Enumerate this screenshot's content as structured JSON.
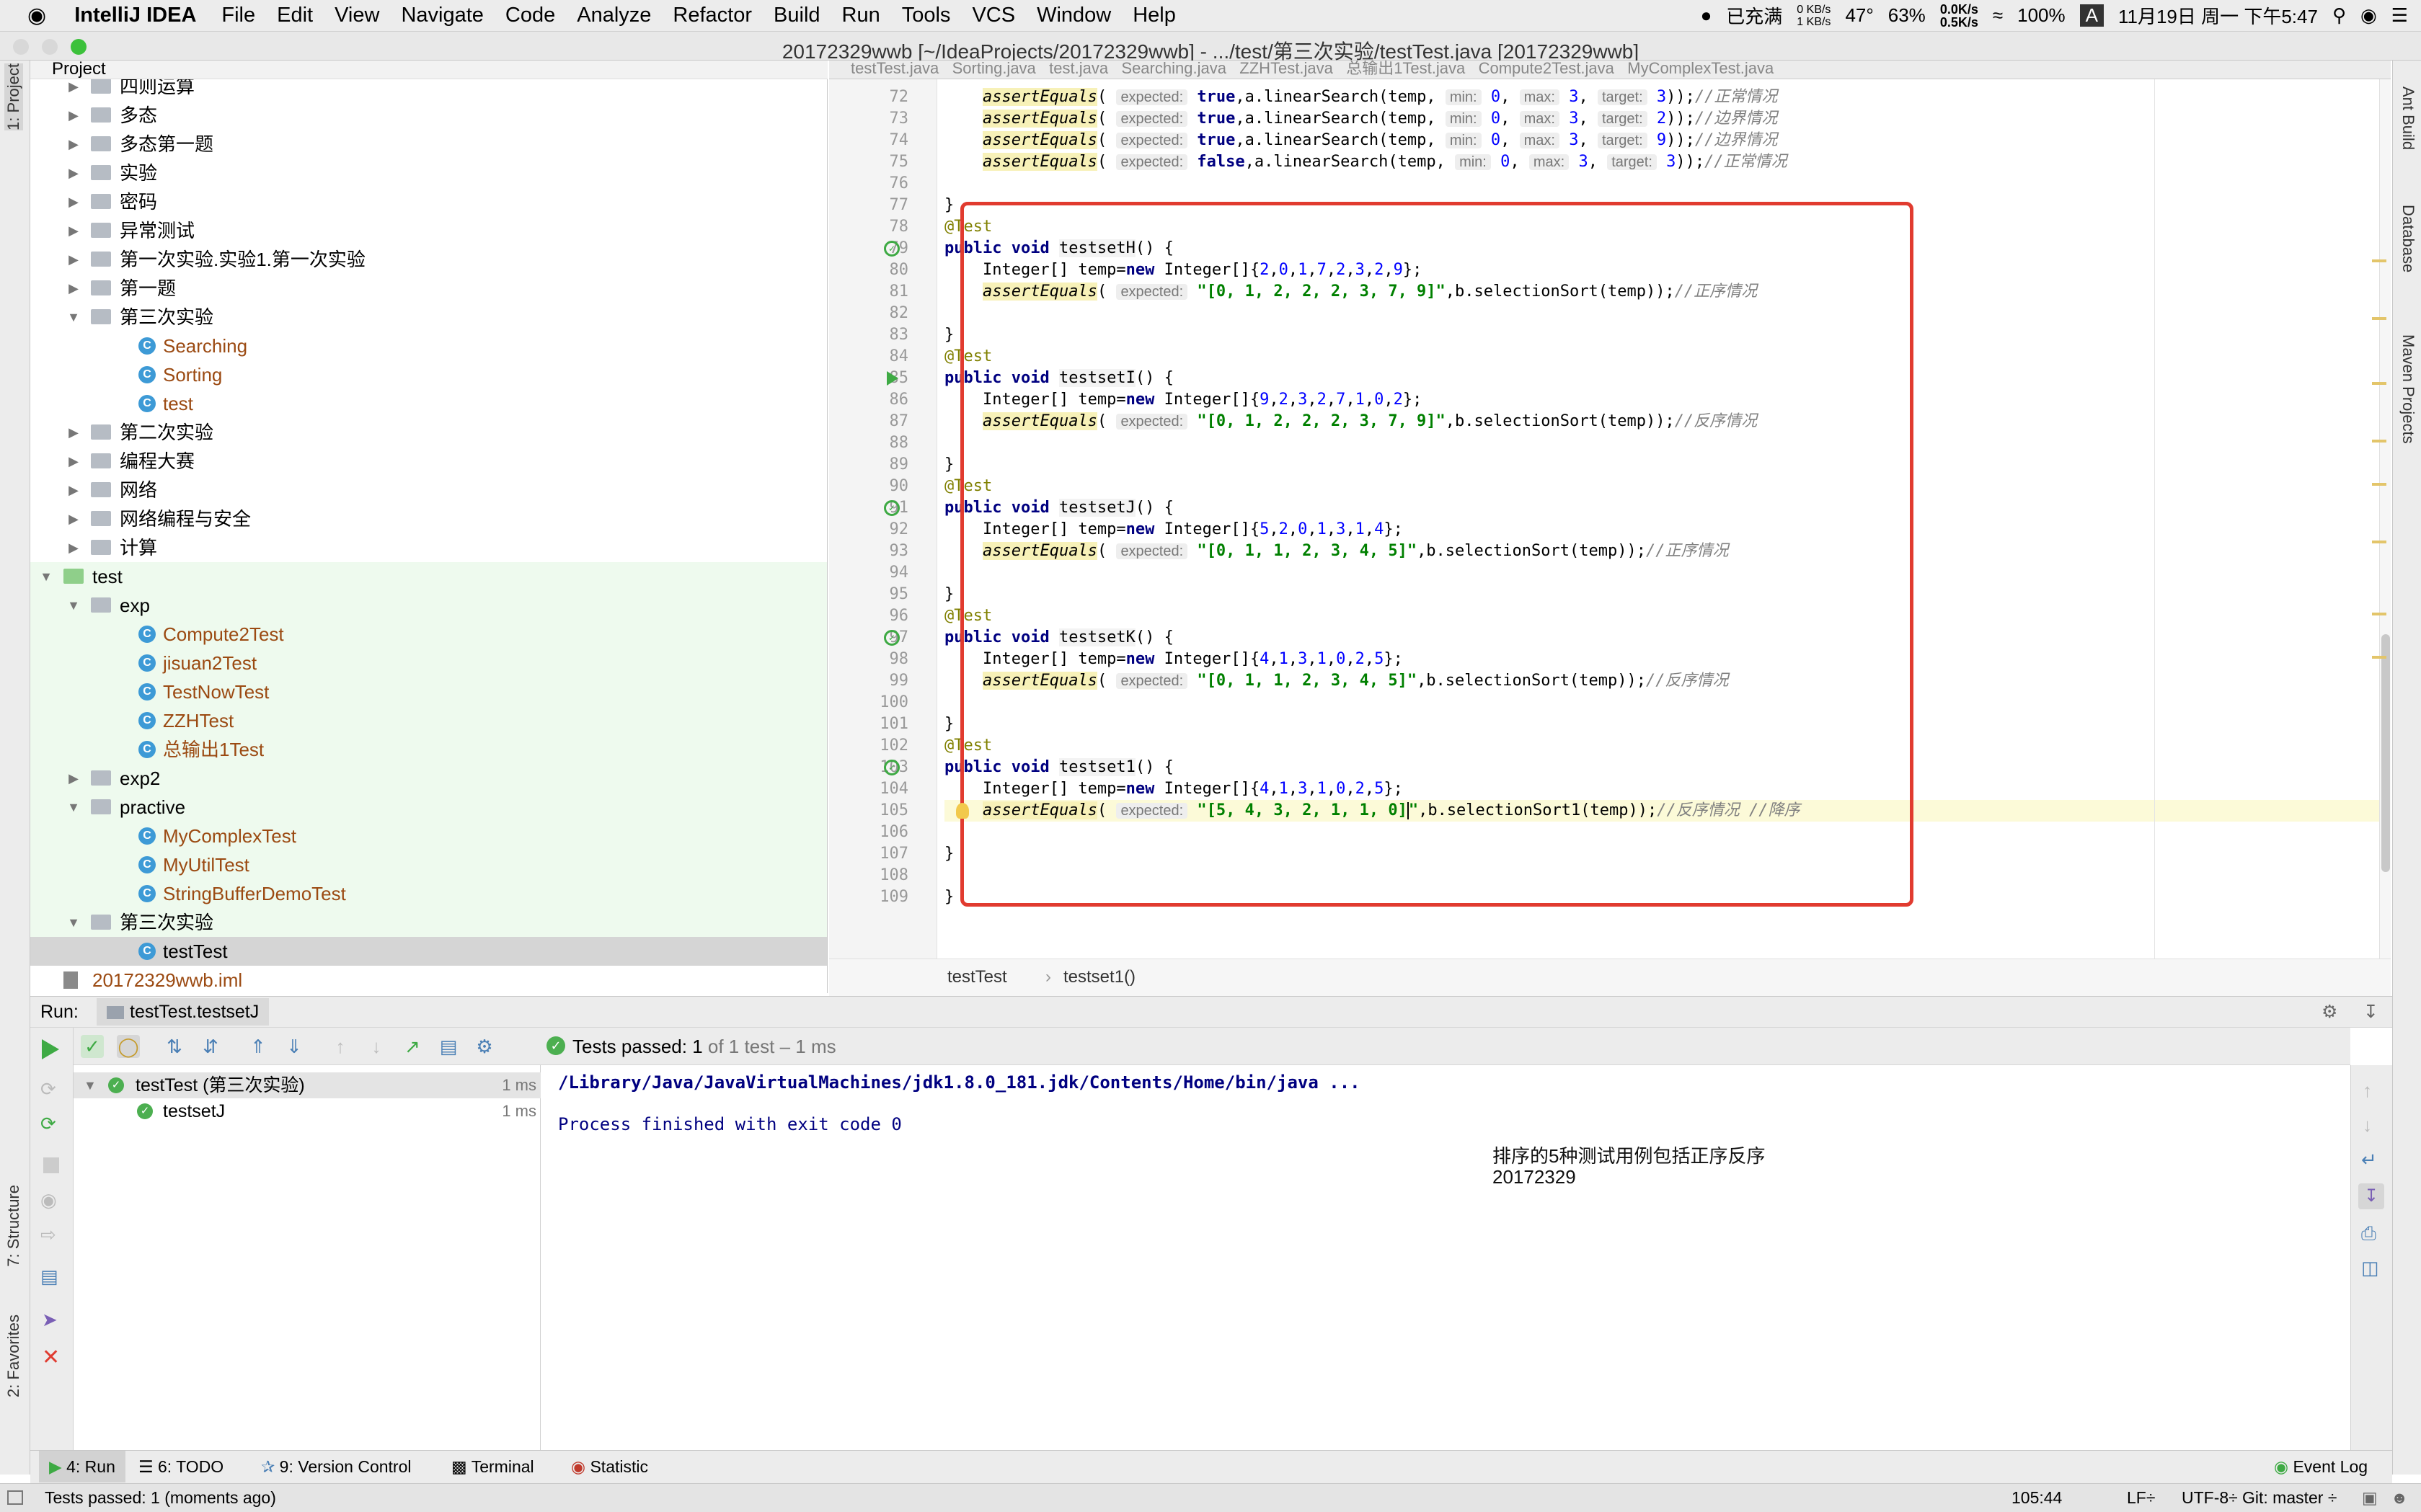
{
  "menubar": {
    "app": "IntelliJ IDEA",
    "items": [
      "File",
      "Edit",
      "View",
      "Navigate",
      "Code",
      "Analyze",
      "Refactor",
      "Build",
      "Run",
      "Tools",
      "VCS",
      "Window",
      "Help"
    ],
    "status": {
      "charge": "已充满",
      "net_up": "0 KB/s",
      "net_down": "1 KB/s",
      "temp": "47°",
      "cpu": "63%",
      "speed_up": "0.0K/s",
      "speed_down": "0.5K/s",
      "battery": "100%",
      "ime": "A",
      "datetime": "11月19日 周一 下午5:47"
    }
  },
  "window": {
    "title": "20172329wwb [~/IdeaProjects/20172329wwb] - .../test/第三次实验/testTest.java [20172329wwb]"
  },
  "tool_windows": {
    "left": [
      "1: Project",
      "7: Structure",
      "2: Favorites"
    ],
    "right": [
      "Ant Build",
      "Database",
      "Maven Projects"
    ]
  },
  "project_panel": {
    "header": "Project",
    "rows": [
      {
        "label": "四则运算",
        "level": 2,
        "type": "folder",
        "expand": "closed",
        "style": "",
        "group": ""
      },
      {
        "label": "多态",
        "level": 2,
        "type": "folder",
        "expand": "closed",
        "style": "",
        "group": ""
      },
      {
        "label": "多态第一题",
        "level": 2,
        "type": "folder",
        "expand": "closed",
        "style": "",
        "group": ""
      },
      {
        "label": "实验",
        "level": 2,
        "type": "folder",
        "expand": "closed",
        "style": "",
        "group": ""
      },
      {
        "label": "密码",
        "level": 2,
        "type": "folder",
        "expand": "closed",
        "style": "",
        "group": ""
      },
      {
        "label": "异常测试",
        "level": 2,
        "type": "folder",
        "expand": "closed",
        "style": "",
        "group": ""
      },
      {
        "label": "第一次实验.实验1.第一次实验",
        "level": 2,
        "type": "folder",
        "expand": "closed",
        "style": "",
        "group": ""
      },
      {
        "label": "第一题",
        "level": 2,
        "type": "folder",
        "expand": "closed",
        "style": "",
        "group": ""
      },
      {
        "label": "第三次实验",
        "level": 2,
        "type": "folder",
        "expand": "open",
        "style": "",
        "group": ""
      },
      {
        "label": "Searching",
        "level": 3,
        "type": "class",
        "expand": "",
        "style": "brown",
        "group": ""
      },
      {
        "label": "Sorting",
        "level": 3,
        "type": "class",
        "expand": "",
        "style": "brown",
        "group": ""
      },
      {
        "label": "test",
        "level": 3,
        "type": "class",
        "expand": "",
        "style": "brown",
        "group": ""
      },
      {
        "label": "第二次实验",
        "level": 2,
        "type": "folder",
        "expand": "closed",
        "style": "",
        "group": ""
      },
      {
        "label": "编程大赛",
        "level": 2,
        "type": "folder",
        "expand": "closed",
        "style": "",
        "group": ""
      },
      {
        "label": "网络",
        "level": 2,
        "type": "folder",
        "expand": "closed",
        "style": "",
        "group": ""
      },
      {
        "label": "网络编程与安全",
        "level": 2,
        "type": "folder",
        "expand": "closed",
        "style": "",
        "group": ""
      },
      {
        "label": "计算",
        "level": 2,
        "type": "folder",
        "expand": "closed",
        "style": "",
        "group": ""
      },
      {
        "label": "test",
        "level": 1,
        "type": "folder-green",
        "expand": "open",
        "style": "",
        "group": "test"
      },
      {
        "label": "exp",
        "level": 2,
        "type": "folder",
        "expand": "open",
        "style": "",
        "group": "test"
      },
      {
        "label": "Compute2Test",
        "level": 3,
        "type": "class",
        "expand": "",
        "style": "brown",
        "group": "test"
      },
      {
        "label": "jisuan2Test",
        "level": 3,
        "type": "class",
        "expand": "",
        "style": "brown",
        "group": "test"
      },
      {
        "label": "TestNowTest",
        "level": 3,
        "type": "class",
        "expand": "",
        "style": "brown",
        "group": "test"
      },
      {
        "label": "ZZHTest",
        "level": 3,
        "type": "class",
        "expand": "",
        "style": "brown",
        "group": "test"
      },
      {
        "label": "总输出1Test",
        "level": 3,
        "type": "class",
        "expand": "",
        "style": "brown",
        "group": "test"
      },
      {
        "label": "exp2",
        "level": 2,
        "type": "folder",
        "expand": "closed",
        "style": "",
        "group": "test"
      },
      {
        "label": "practive",
        "level": 2,
        "type": "folder",
        "expand": "open",
        "style": "",
        "group": "test"
      },
      {
        "label": "MyComplexTest",
        "level": 3,
        "type": "class",
        "expand": "",
        "style": "brown",
        "group": "test"
      },
      {
        "label": "MyUtilTest",
        "level": 3,
        "type": "class",
        "expand": "",
        "style": "brown",
        "group": "test"
      },
      {
        "label": "StringBufferDemoTest",
        "level": 3,
        "type": "class",
        "expand": "",
        "style": "brown",
        "group": "test"
      },
      {
        "label": "第三次实验",
        "level": 2,
        "type": "folder",
        "expand": "open",
        "style": "",
        "group": "test"
      },
      {
        "label": "testTest",
        "level": 3,
        "type": "class",
        "expand": "",
        "style": "",
        "group": "selected"
      },
      {
        "label": "20172329wwb.iml",
        "level": 1,
        "type": "iml",
        "expand": "",
        "style": "brown",
        "group": ""
      }
    ]
  },
  "editor": {
    "tabs": "testTest.java   Sorting.java   test.java   Searching.java   ZZHTest.java   总输出1Test.java   Compute2Test.java   MyComplexTest.java",
    "lines": [
      {
        "n": "72",
        "cls": "",
        "c": "    <span class='ae'>assertEquals</span>( <span class='hint'>expected:</span> <span class='kw'>true</span>,a.linearSearch(temp, <span class='hint'>min:</span> <span class='nm'>0</span>, <span class='hint'>max:</span> <span class='nm'>3</span>, <span class='hint'>target:</span> <span class='nm'>3</span>));<span class='cm'>//正常情况</span>"
      },
      {
        "n": "73",
        "cls": "",
        "c": "    <span class='ae'>assertEquals</span>( <span class='hint'>expected:</span> <span class='kw'>true</span>,a.linearSearch(temp, <span class='hint'>min:</span> <span class='nm'>0</span>, <span class='hint'>max:</span> <span class='nm'>3</span>, <span class='hint'>target:</span> <span class='nm'>2</span>));<span class='cm'>//边界情况</span>"
      },
      {
        "n": "74",
        "cls": "",
        "c": "    <span class='ae'>assertEquals</span>( <span class='hint'>expected:</span> <span class='kw'>true</span>,a.linearSearch(temp, <span class='hint'>min:</span> <span class='nm'>0</span>, <span class='hint'>max:</span> <span class='nm'>3</span>, <span class='hint'>target:</span> <span class='nm'>9</span>));<span class='cm'>//边界情况</span>"
      },
      {
        "n": "75",
        "cls": "",
        "c": "    <span class='ae'>assertEquals</span>( <span class='hint'>expected:</span> <span class='kw'>false</span>,a.linearSearch(temp, <span class='hint'>min:</span> <span class='nm'>0</span>, <span class='hint'>max:</span> <span class='nm'>3</span>, <span class='hint'>target:</span> <span class='nm'>3</span>));<span class='cm'>//正常情况</span>"
      },
      {
        "n": "76",
        "cls": "",
        "c": ""
      },
      {
        "n": "77",
        "cls": "",
        "c": "}"
      },
      {
        "n": "78",
        "cls": "",
        "c": "<span class='an'>@Test</span>"
      },
      {
        "n": "79",
        "cls": "",
        "c": "<span class='kw'>public void</span> <span class='fn'>testsetH</span>() {"
      },
      {
        "n": "80",
        "cls": "",
        "c": "    Integer[] temp=<span class='kw'>new</span> Integer[]{<span class='nm'>2</span>,<span class='nm'>0</span>,<span class='nm'>1</span>,<span class='nm'>7</span>,<span class='nm'>2</span>,<span class='nm'>3</span>,<span class='nm'>2</span>,<span class='nm'>9</span>};"
      },
      {
        "n": "81",
        "cls": "",
        "c": "    <span class='ae'>assertEquals</span>( <span class='hint'>expected:</span> <span class='str'>\"[0, 1, 2, 2, 2, 3, 7, 9]\"</span>,b.selectionSort(temp));<span class='cm'>//正序情况</span>"
      },
      {
        "n": "82",
        "cls": "",
        "c": ""
      },
      {
        "n": "83",
        "cls": "",
        "c": "}"
      },
      {
        "n": "84",
        "cls": "",
        "c": "<span class='an'>@Test</span>"
      },
      {
        "n": "85",
        "cls": "",
        "c": "<span class='kw'>public void</span> <span class='fn'>testsetI</span>() {"
      },
      {
        "n": "86",
        "cls": "",
        "c": "    Integer[] temp=<span class='kw'>new</span> Integer[]{<span class='nm'>9</span>,<span class='nm'>2</span>,<span class='nm'>3</span>,<span class='nm'>2</span>,<span class='nm'>7</span>,<span class='nm'>1</span>,<span class='nm'>0</span>,<span class='nm'>2</span>};"
      },
      {
        "n": "87",
        "cls": "",
        "c": "    <span class='ae'>assertEquals</span>( <span class='hint'>expected:</span> <span class='str'>\"[0, 1, 2, 2, 2, 3, 7, 9]\"</span>,b.selectionSort(temp));<span class='cm'>//反序情况</span>"
      },
      {
        "n": "88",
        "cls": "",
        "c": ""
      },
      {
        "n": "89",
        "cls": "",
        "c": "}"
      },
      {
        "n": "90",
        "cls": "",
        "c": "<span class='an'>@Test</span>"
      },
      {
        "n": "91",
        "cls": "",
        "c": "<span class='kw'>public void</span> <span class='fn'>testsetJ</span>() {"
      },
      {
        "n": "92",
        "cls": "",
        "c": "    Integer[] temp=<span class='kw'>new</span> Integer[]{<span class='nm'>5</span>,<span class='nm'>2</span>,<span class='nm'>0</span>,<span class='nm'>1</span>,<span class='nm'>3</span>,<span class='nm'>1</span>,<span class='nm'>4</span>};"
      },
      {
        "n": "93",
        "cls": "",
        "c": "    <span class='ae'>assertEquals</span>( <span class='hint'>expected:</span> <span class='str'>\"[0, 1, 1, 2, 3, 4, 5]\"</span>,b.selectionSort(temp));<span class='cm'>//正序情况</span>"
      },
      {
        "n": "94",
        "cls": "",
        "c": ""
      },
      {
        "n": "95",
        "cls": "",
        "c": "}"
      },
      {
        "n": "96",
        "cls": "",
        "c": "<span class='an'>@Test</span>"
      },
      {
        "n": "97",
        "cls": "",
        "c": "<span class='kw'>public void</span> <span class='fn'>testsetK</span>() {"
      },
      {
        "n": "98",
        "cls": "",
        "c": "    Integer[] temp=<span class='kw'>new</span> Integer[]{<span class='nm'>4</span>,<span class='nm'>1</span>,<span class='nm'>3</span>,<span class='nm'>1</span>,<span class='nm'>0</span>,<span class='nm'>2</span>,<span class='nm'>5</span>};"
      },
      {
        "n": "99",
        "cls": "",
        "c": "    <span class='ae'>assertEquals</span>( <span class='hint'>expected:</span> <span class='str'>\"[0, 1, 1, 2, 3, 4, 5]\"</span>,b.selectionSort(temp));<span class='cm'>//反序情况</span>"
      },
      {
        "n": "100",
        "cls": "",
        "c": ""
      },
      {
        "n": "101",
        "cls": "",
        "c": "}"
      },
      {
        "n": "102",
        "cls": "",
        "c": "<span class='an'>@Test</span>"
      },
      {
        "n": "103",
        "cls": "",
        "c": "<span class='kw'>public void</span> <span class='fn'>testset1</span>() {"
      },
      {
        "n": "104",
        "cls": "",
        "c": "    Integer[] temp=<span class='kw'>new</span> Integer[]{<span class='nm'>4</span>,<span class='nm'>1</span>,<span class='nm'>3</span>,<span class='nm'>1</span>,<span class='nm'>0</span>,<span class='nm'>2</span>,<span class='nm'>5</span>};"
      },
      {
        "n": "105",
        "cls": "cur",
        "c": "    <span class='ae'>assertEquals</span>( <span class='hint'>expected:</span> <span class='str'>\"[5, 4, 3, 2, 1, 1, 0]<span class='caret'></span>\"</span>,b.selectionSort1(temp));<span class='cm'>//反序情况 //降序</span>"
      },
      {
        "n": "106",
        "cls": "",
        "c": ""
      },
      {
        "n": "107",
        "cls": "",
        "c": "}"
      },
      {
        "n": "108",
        "cls": "",
        "c": ""
      },
      {
        "n": "109",
        "cls": "",
        "c": "}"
      }
    ]
  },
  "breadcrumb": {
    "class": "testTest",
    "method": "testset1()"
  },
  "run_panel": {
    "label": "Run:",
    "tab": "testTest.testsetJ",
    "passed_bold": "Tests passed: 1",
    "passed_rest": "of 1 test – 1 ms",
    "tree": [
      {
        "name": "testTest (第三次实验)",
        "time": "1 ms"
      },
      {
        "name": "testsetJ",
        "time": "1 ms"
      }
    ],
    "console": [
      "/Library/Java/JavaVirtualMachines/jdk1.8.0_181.jdk/Contents/Home/bin/java ...",
      "Process finished with exit code 0"
    ],
    "annotation": [
      "排序的5种测试用例包括正序反序",
      "20172329"
    ]
  },
  "bottom_tabs": {
    "run": "4: Run",
    "todo": "6: TODO",
    "vcs": "9: Version Control",
    "terminal": "Terminal",
    "statistic": "Statistic",
    "event_log": "Event Log"
  },
  "statusbar": {
    "message": "Tests passed: 1 (moments ago)",
    "position": "105:44",
    "line_sep": "LF÷",
    "encoding": "UTF-8÷",
    "git": "Git: master ÷"
  },
  "colors": {
    "highlight_box": "#e13b2f",
    "pass": "#4caf50",
    "run_green": "#3eaa44"
  }
}
